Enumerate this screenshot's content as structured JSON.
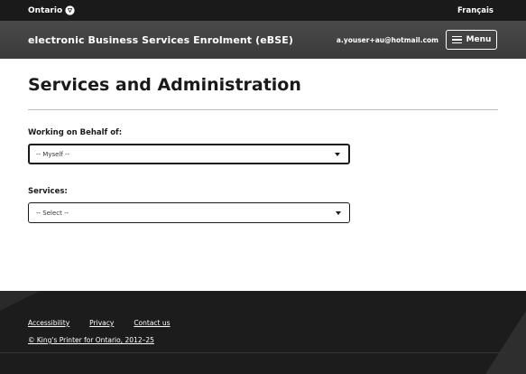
{
  "topbar": {
    "logo_text": "Ontario",
    "language_link": "Français"
  },
  "header": {
    "app_title": "electronic Business Services Enrolment (eBSE)",
    "user_email": "a.youser+au@hotmail.com",
    "menu_label": "Menu"
  },
  "main": {
    "page_title": "Services and Administration",
    "behalf": {
      "label": "Working on Behalf of:",
      "selected": "-- Myself --"
    },
    "services": {
      "label": "Services:",
      "selected": "-- Select --"
    }
  },
  "footer": {
    "links": [
      "Accessibility",
      "Privacy",
      "Contact us"
    ],
    "copyright": "© King's Printer for Ontario, 2012–25"
  },
  "colors": {
    "topbar_bg": "#1a1a1a",
    "appbar_bg": "#3f3f3f",
    "footer_bg": "#1c1c1c"
  }
}
